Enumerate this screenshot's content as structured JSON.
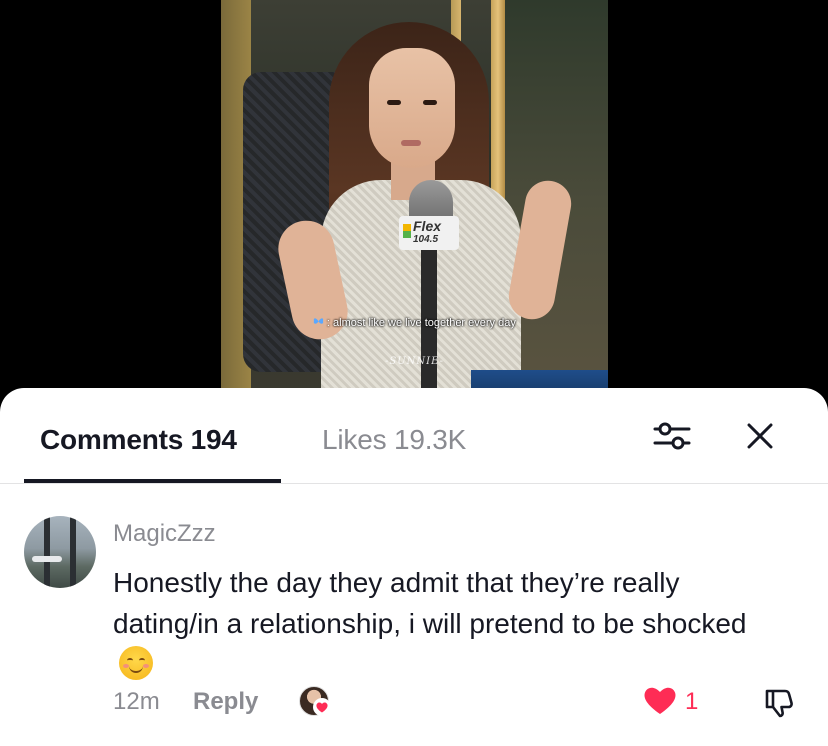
{
  "video": {
    "mic_brand": "Flex",
    "mic_frequency": "104.5",
    "caption_icon": "butterfly-icon",
    "caption": ": almost like we live together every day",
    "watermark": "-SUNNIE-"
  },
  "sheet": {
    "tabs": [
      {
        "label": "Comments 194",
        "active": true
      },
      {
        "label": "Likes 19.3K",
        "active": false
      }
    ],
    "filter_icon": "sliders-icon",
    "close_icon": "close-icon"
  },
  "comment": {
    "username": "MagicZzz",
    "text": "Honestly the day they admit that they’re really dating/in a relationship, i will pretend to be shocked",
    "emoji": "smiling-face-icon",
    "time": "12m",
    "reply_label": "Reply",
    "like_count": "1",
    "colors": {
      "like": "#fe2c55",
      "primary_text": "#161823",
      "secondary_text": "#8a8b91"
    }
  }
}
